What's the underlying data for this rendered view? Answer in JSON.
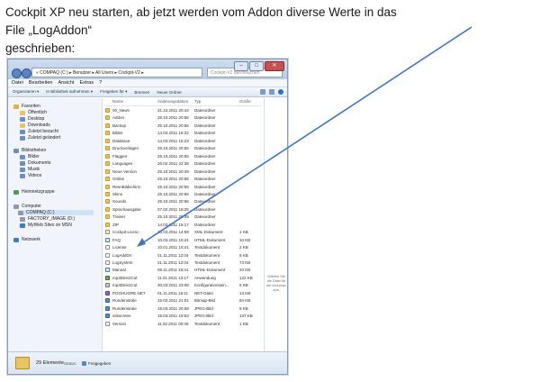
{
  "caption": {
    "line1": "Cockpit XP neu starten, ab jetzt werden vom Addon diverse Werte in das File „LogAddon“",
    "line2": "geschrieben:"
  },
  "window": {
    "address": "« COMPAQ (C:) ▸ Benutzer ▸ All Users ▸ Cockpit-V2 ▸",
    "search_placeholder": "Cockpit-V2 durchsuchen",
    "window_buttons": [
      "–",
      "□",
      "✕"
    ]
  },
  "menu": [
    "Datei",
    "Bearbeiten",
    "Ansicht",
    "Extras",
    "?"
  ],
  "toolbar": [
    "Organisieren ▾",
    "In Bibliothek aufnehmen ▾",
    "Freigeben für ▾",
    "Brennen",
    "Neuer Ordner"
  ],
  "nav": {
    "favorites_label": "Favoriten",
    "favorites": [
      "Öffentlich",
      "Desktop",
      "Downloads",
      "Zuletzt besucht",
      "Zuletzt geändert"
    ],
    "libraries_label": "Bibliotheken",
    "libraries": [
      "Bilder",
      "Dokumente",
      "Musik",
      "Videos"
    ],
    "homegroup": "Heimnetzgruppe",
    "computer_label": "Computer",
    "drives": [
      "COMPAQ (C:)",
      "FACTORY_IMAGE (D:)",
      "MyWeb Sites on MSN"
    ],
    "network": "Netzwerk"
  },
  "columns": {
    "name": "Name",
    "date": "Änderungsdatum",
    "type": "Typ",
    "size": "Größe"
  },
  "files": [
    {
      "name": "00_News",
      "date": "31.10.2011 20:44",
      "type": "Dateiordner",
      "size": "",
      "icon": "folder"
    },
    {
      "name": "Addon",
      "date": "25.10.2011 20:56",
      "type": "Dateiordner",
      "size": "",
      "icon": "folder"
    },
    {
      "name": "Backup",
      "date": "25.10.2011 20:56",
      "type": "Dateiordner",
      "size": "",
      "icon": "folder"
    },
    {
      "name": "Bilder",
      "date": "14.03.2011 16:22",
      "type": "Dateiordner",
      "size": "",
      "icon": "folder"
    },
    {
      "name": "Database",
      "date": "14.03.2011 16:23",
      "type": "Dateiordner",
      "size": "",
      "icon": "folder"
    },
    {
      "name": "Druckvorlagen",
      "date": "25.10.2011 20:55",
      "type": "Dateiordner",
      "size": "",
      "icon": "folder"
    },
    {
      "name": "Flaggen",
      "date": "25.10.2011 20:55",
      "type": "Dateiordner",
      "size": "",
      "icon": "folder"
    },
    {
      "name": "Languages",
      "date": "26.02.2011 22:38",
      "type": "Dateiordner",
      "size": "",
      "icon": "folder"
    },
    {
      "name": "Neue Version",
      "date": "25.10.2011 20:49",
      "type": "Dateiordner",
      "size": "",
      "icon": "folder"
    },
    {
      "name": "Online",
      "date": "25.10.2011 20:56",
      "type": "Dateiordner",
      "size": "",
      "icon": "folder"
    },
    {
      "name": "RennBildschirm",
      "date": "25.10.2011 20:55",
      "type": "Dateiordner",
      "size": "",
      "icon": "folder"
    },
    {
      "name": "Skins",
      "date": "25.10.2011 20:55",
      "type": "Dateiordner",
      "size": "",
      "icon": "folder"
    },
    {
      "name": "Sounds",
      "date": "25.10.2011 20:56",
      "type": "Dateiordner",
      "size": "",
      "icon": "folder"
    },
    {
      "name": "Sprachausgabe",
      "date": "07.02.2011 18:25",
      "type": "Dateiordner",
      "size": "",
      "icon": "folder"
    },
    {
      "name": "Trainer",
      "date": "25.10.2011 20:49",
      "type": "Dateiordner",
      "size": "",
      "icon": "folder"
    },
    {
      "name": "ZIP",
      "date": "14.03.2011 16:17",
      "type": "Dateiordner",
      "size": "",
      "icon": "folder"
    },
    {
      "name": "Cockpit-Licenc",
      "date": "10.03.2011 14:59",
      "type": "XML-Dokument",
      "size": "1 KB",
      "icon": "xml"
    },
    {
      "name": "FAQ",
      "date": "10.03.2011 15:41",
      "type": "HTML-Dokument",
      "size": "10 KB",
      "icon": "html"
    },
    {
      "name": "License",
      "date": "10.01.2011 15:41",
      "type": "Textdokument",
      "size": "2 KB",
      "icon": "file"
    },
    {
      "name": "LogAddOn",
      "date": "01.11.2011 12:04",
      "type": "Textdokument",
      "size": "8 KB",
      "icon": "file"
    },
    {
      "name": "LogSystem",
      "date": "01.11.2011 12:04",
      "type": "Textdokument",
      "size": "73 KB",
      "icon": "file"
    },
    {
      "name": "Manual",
      "date": "05.11.2011 15:41",
      "type": "HTML-Dokument",
      "size": "20 KB",
      "icon": "html"
    },
    {
      "name": "mp3DirectCut",
      "date": "11.01.2011 13:17",
      "type": "Anwendung",
      "size": "122 KB",
      "icon": "app"
    },
    {
      "name": "mp3DirectCut",
      "date": "30.03.2011 23:08",
      "type": "Konfigurationsein...",
      "size": "5 KB",
      "icon": "cfg"
    },
    {
      "name": "POGHUGRE.NET",
      "date": "01.11.2011 19:11",
      "type": "NET-Datei",
      "size": "13 KB",
      "icon": "net"
    },
    {
      "name": "Rundenstrale",
      "date": "15.03.2011 21:01",
      "type": "Bitmap-Bild",
      "size": "84 KB",
      "icon": "img"
    },
    {
      "name": "Rundenstrale",
      "date": "15.03.2011 20:58",
      "type": "JPEG-Bild",
      "size": "8 KB",
      "icon": "img"
    },
    {
      "name": "ssbscreen",
      "date": "15.03.2011 19:53",
      "type": "JPEG-Bild",
      "size": "137 KB",
      "icon": "img"
    },
    {
      "name": "Version",
      "date": "11.02.2011 00:40",
      "type": "Textdokument",
      "size": "1 KB",
      "icon": "file"
    }
  ],
  "preview_text": "Wählen Sie die Datei für die Vorschau aus.",
  "details": {
    "count": "29 Elemente",
    "status_label": "Status:",
    "shared": "Freigegeben"
  },
  "colors": {
    "arrow": "#3f74c4",
    "selection": "#cfe2f7",
    "folder": "#e9c463"
  }
}
